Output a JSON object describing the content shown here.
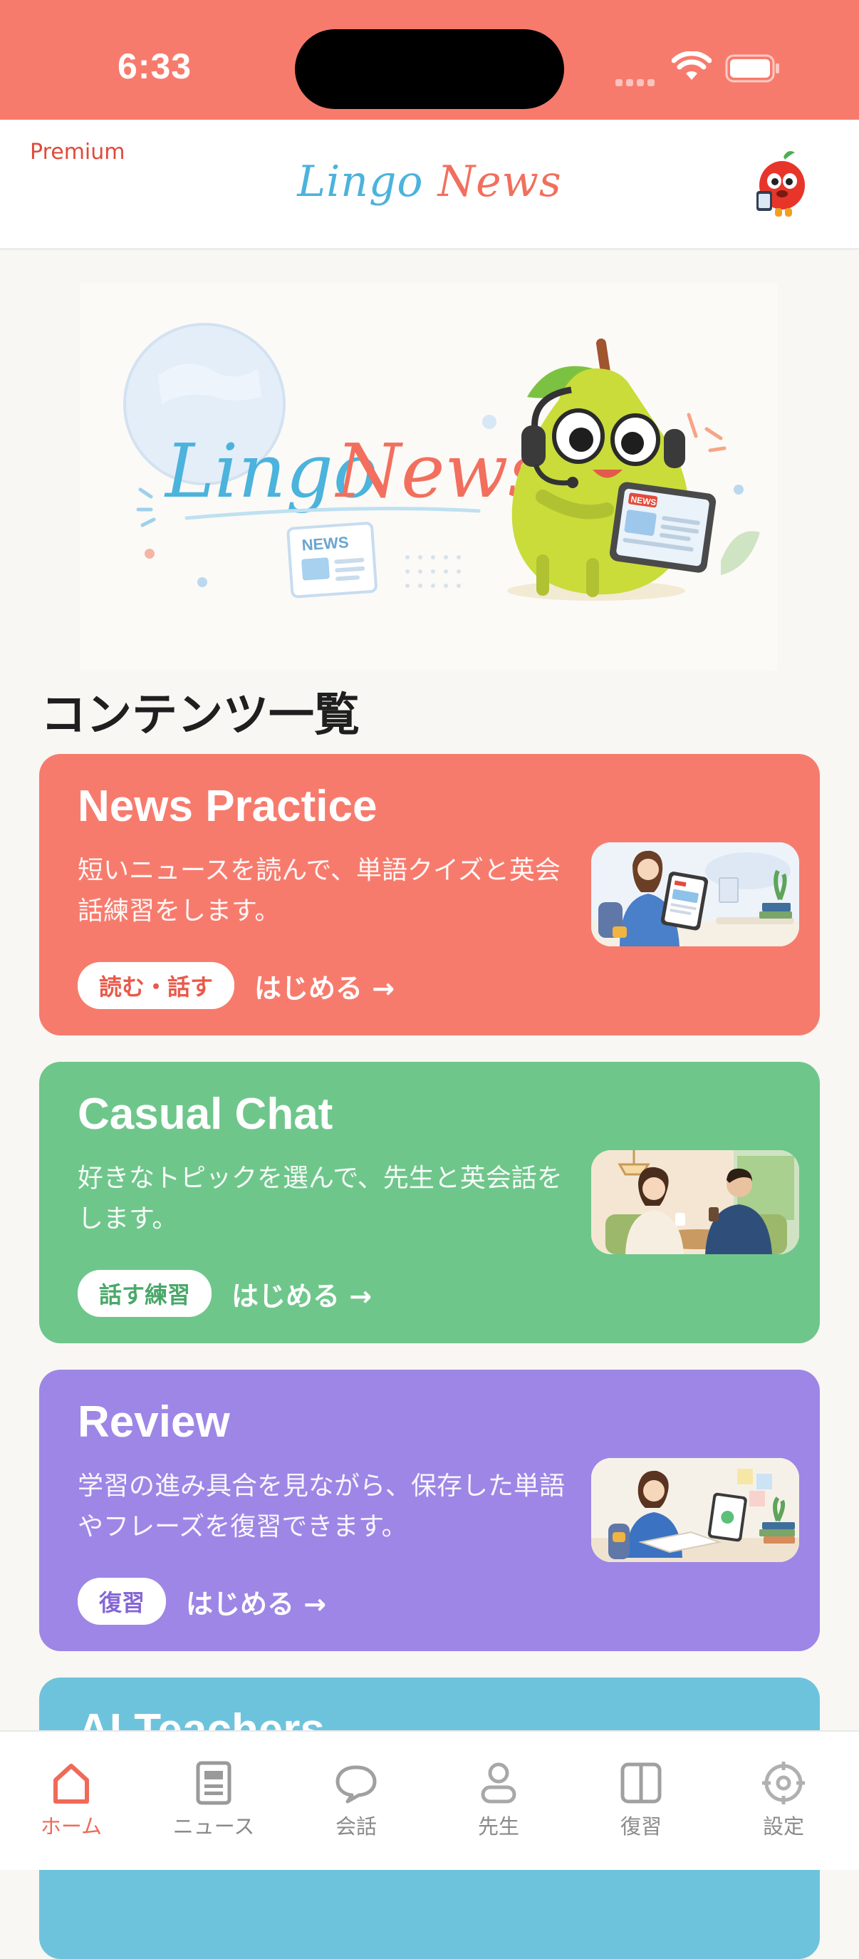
{
  "status_bar": {
    "time": "6:33"
  },
  "header": {
    "premium_label": "Premium",
    "logo_word1": "Lingo",
    "logo_word2": "News"
  },
  "hero": {
    "title_word1": "Lingo",
    "title_word2": "News",
    "tablet_label": "NEWS",
    "paper_label": "NEWS"
  },
  "section_title": "コンテンツ一覧",
  "cards": [
    {
      "title": "News Practice",
      "description": "短いニュースを読んで、単語クイズと英会話練習をします。",
      "tag": "読む・話す",
      "start": "はじめる →",
      "color": "#f77b6d",
      "tag_color": "#e9594a"
    },
    {
      "title": "Casual Chat",
      "description": "好きなトピックを選んで、先生と英会話をします。",
      "tag": "話す練習",
      "start": "はじめる →",
      "color": "#6fc68b",
      "tag_color": "#4aa86a"
    },
    {
      "title": "Review",
      "description": "学習の進み具合を見ながら、保存した単語やフレーズを復習できます。",
      "tag": "復習",
      "start": "はじめる →",
      "color": "#9e86e6",
      "tag_color": "#8467d6"
    },
    {
      "title": "AI Teachers",
      "color": "#6ec3dc"
    }
  ],
  "tabs": [
    {
      "label": "ホーム",
      "icon": "home-icon",
      "active": true
    },
    {
      "label": "ニュース",
      "icon": "news-icon",
      "active": false
    },
    {
      "label": "会話",
      "icon": "chat-bubble-icon",
      "active": false
    },
    {
      "label": "先生",
      "icon": "person-icon",
      "active": false
    },
    {
      "label": "復習",
      "icon": "book-icon",
      "active": false
    },
    {
      "label": "設定",
      "icon": "gear-icon",
      "active": false
    }
  ],
  "colors": {
    "accent": "#f77b6d",
    "tab_active": "#ef6a58",
    "tab_inactive": "#8a8a8a"
  }
}
